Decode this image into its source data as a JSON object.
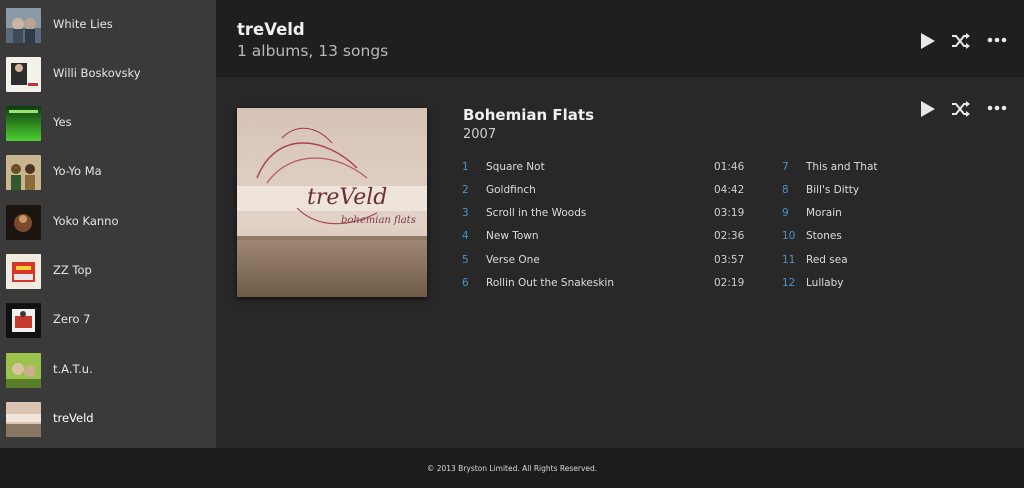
{
  "sidebar": {
    "artists": [
      {
        "name": "White Lies"
      },
      {
        "name": "Willi Boskovsky"
      },
      {
        "name": "Yes"
      },
      {
        "name": "Yo-Yo Ma"
      },
      {
        "name": "Yoko Kanno"
      },
      {
        "name": "ZZ Top"
      },
      {
        "name": "Zero 7"
      },
      {
        "name": "t.A.T.u."
      },
      {
        "name": "treVeld",
        "selected": true
      }
    ]
  },
  "header": {
    "artist_name": "treVeld",
    "summary": "1 albums, 13 songs",
    "controls": [
      "play-icon",
      "shuffle-icon",
      "more-icon"
    ]
  },
  "album": {
    "title": "Bohemian Flats",
    "year": "2007",
    "art_text": "treVeld",
    "art_subtext": "bohemian flats",
    "controls": [
      "play-icon",
      "shuffle-icon",
      "more-icon"
    ],
    "tracks": [
      {
        "num": "1",
        "title": "Square Not",
        "duration": "01:46"
      },
      {
        "num": "2",
        "title": "Goldfinch",
        "duration": "04:42"
      },
      {
        "num": "3",
        "title": "Scroll in the Woods",
        "duration": "03:19"
      },
      {
        "num": "4",
        "title": "New Town",
        "duration": "02:36"
      },
      {
        "num": "5",
        "title": "Verse One",
        "duration": "03:57"
      },
      {
        "num": "6",
        "title": "Rollin Out the Snakeskin",
        "duration": "02:19"
      },
      {
        "num": "7",
        "title": "This and That"
      },
      {
        "num": "8",
        "title": "Bill's Ditty"
      },
      {
        "num": "9",
        "title": "Morain"
      },
      {
        "num": "10",
        "title": "Stones"
      },
      {
        "num": "11",
        "title": "Red sea"
      },
      {
        "num": "12",
        "title": "Lullaby"
      }
    ]
  },
  "footer": {
    "copyright": "© 2013 Bryston Limited. All Rights Reserved."
  },
  "colors": {
    "accent_track_number": "#4a93c9",
    "sidebar_bg": "#3a3a3a",
    "header_bg": "#1f1f1f"
  }
}
